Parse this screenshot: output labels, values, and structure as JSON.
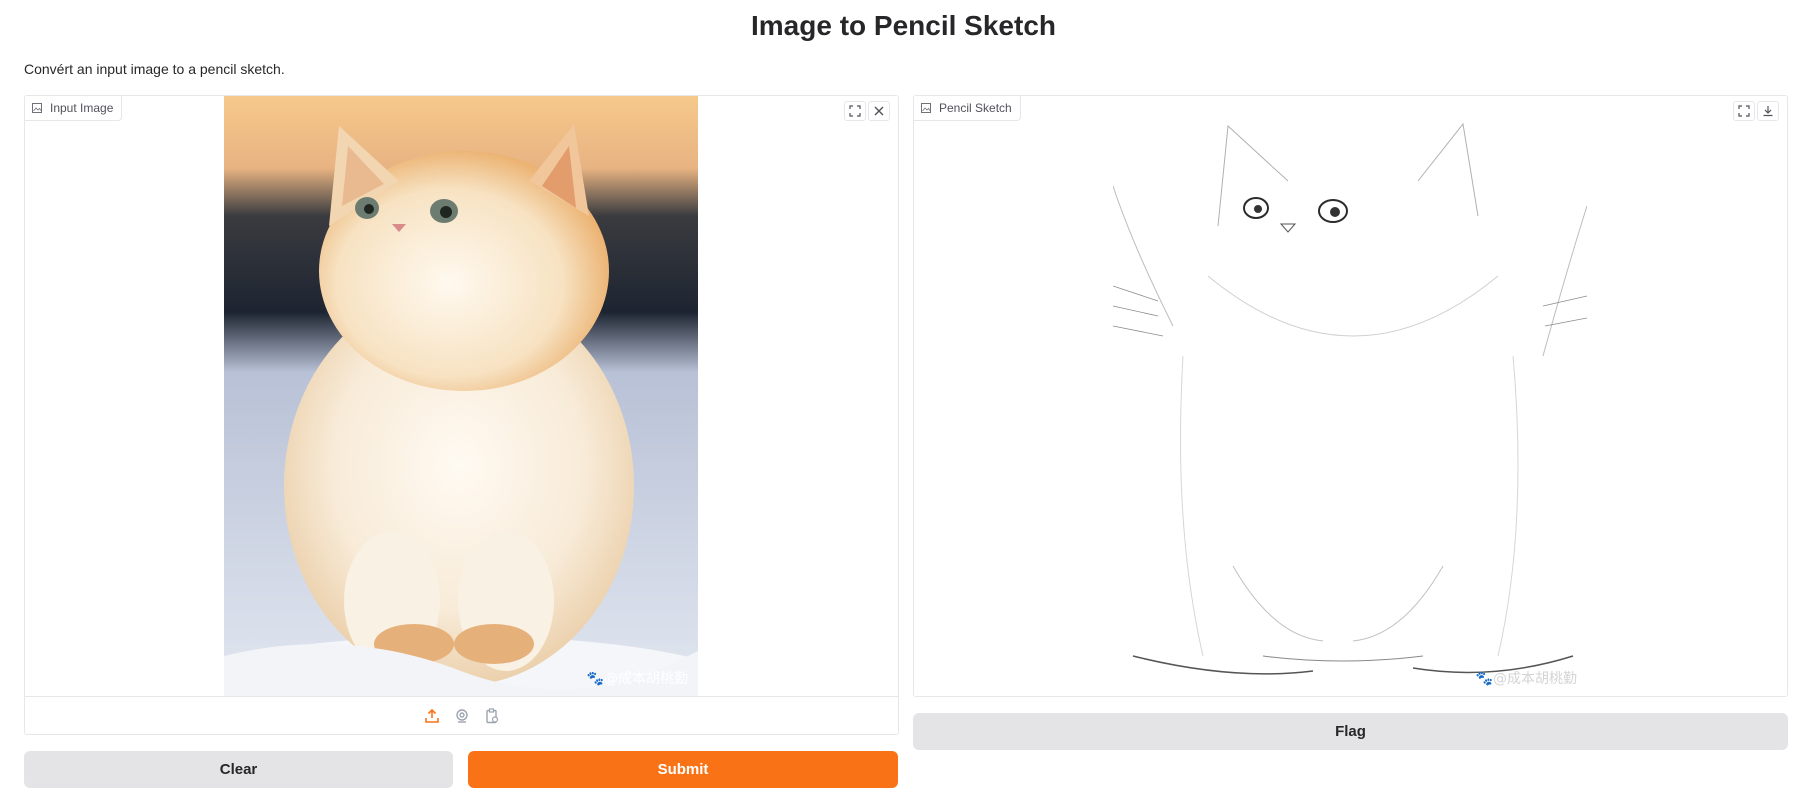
{
  "page": {
    "title": "Image to Pencil Sketch",
    "description": "Convért an input image to a pencil sketch."
  },
  "input_panel": {
    "label": "Input Image",
    "toolbar": [
      {
        "icon": "fullscreen-icon"
      },
      {
        "icon": "close-icon"
      }
    ],
    "sources": [
      {
        "icon": "upload-icon",
        "active": true
      },
      {
        "icon": "webcam-icon",
        "active": false
      },
      {
        "icon": "clipboard-icon",
        "active": false
      }
    ],
    "watermark": "🐾@成本胡桃勤"
  },
  "output_panel": {
    "label": "Pencil Sketch",
    "toolbar": [
      {
        "icon": "fullscreen-icon"
      },
      {
        "icon": "download-icon"
      }
    ],
    "watermark": "🐾@成本胡桃勤"
  },
  "buttons": {
    "clear": "Clear",
    "submit": "Submit",
    "flag": "Flag"
  },
  "colors": {
    "accent": "#f97316",
    "secondary_button": "#e4e4e7",
    "border": "#e5e7eb"
  }
}
